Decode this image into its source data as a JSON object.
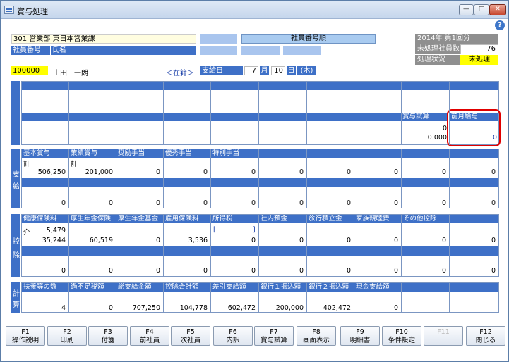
{
  "window": {
    "title": "賞与処理",
    "min": "—",
    "max": "□",
    "close": "✕"
  },
  "header": {
    "dept": "301 営業部 東日本営業課",
    "emp_no_label": "社員番号",
    "name_label": "氏名",
    "emp_no": "100000",
    "name": "山田　一朗",
    "status": "＜在籍＞",
    "btn_a": "",
    "btn_b": "",
    "btn_c": "",
    "btn_d": "",
    "btn_e": "",
    "order": "社員番号順",
    "pay_date_label": "支給日",
    "month": "7",
    "month_unit": "月",
    "day": "10",
    "day_unit": "日",
    "weekday": "(木)",
    "period": "2014年 第1回分",
    "unproc_label": "未処理社員数",
    "unproc_count": "76",
    "proc_label": "処理状況",
    "proc_value": "未処理"
  },
  "top": {
    "h_shoyo": "賞与試算",
    "h_zengetsu": "前月給与",
    "v1": "0",
    "v2": "0.000",
    "v3": "0"
  },
  "pay": {
    "side": [
      "支",
      "給"
    ],
    "headers": [
      "基本賞与",
      "業績賞与",
      "奨励手当",
      "優秀手当",
      "特別手当",
      "",
      "",
      "",
      "",
      ""
    ],
    "sub": [
      "計",
      "計",
      "",
      "",
      "",
      "",
      "",
      "",
      "",
      ""
    ],
    "row1": [
      "506,250",
      "201,000",
      "0",
      "0",
      "0",
      "0",
      "0",
      "0",
      "0",
      "0"
    ],
    "row2": [
      "0",
      "0",
      "0",
      "0",
      "0",
      "0",
      "0",
      "0",
      "0",
      "0"
    ]
  },
  "ded": {
    "side": [
      "控",
      "除"
    ],
    "headers": [
      "健康保険料",
      "厚生年金保険",
      "厚生年金基金",
      "雇用保険料",
      "所得税",
      "社内預金",
      "旅行積立金",
      "家族親睦費",
      "その他控除",
      ""
    ],
    "kaigo": "介",
    "kaigo_val": "5,479",
    "br_open": "[",
    "br_close": "]",
    "row1": [
      "35,244",
      "60,519",
      "0",
      "3,536",
      "0",
      "0",
      "0",
      "0",
      "0",
      "0"
    ],
    "row2": [
      "0",
      "0",
      "0",
      "0",
      "0",
      "0",
      "0",
      "0",
      "0",
      "0"
    ]
  },
  "calc": {
    "side": [
      "計",
      "算"
    ],
    "headers": [
      "扶養等の数",
      "過不足税額",
      "総支給金額",
      "控除合計額",
      "差引支給額",
      "銀行１振込額",
      "銀行２振込額",
      "現金支給額",
      "",
      ""
    ],
    "row": [
      "4",
      "0",
      "707,250",
      "104,778",
      "602,472",
      "200,000",
      "402,472",
      "0",
      "",
      ""
    ]
  },
  "fkeys": [
    {
      "k": "F1",
      "l": "操作説明"
    },
    {
      "k": "F2",
      "l": "印刷"
    },
    {
      "k": "F3",
      "l": "付箋"
    },
    {
      "k": "F4",
      "l": "前社員"
    },
    {
      "k": "F5",
      "l": "次社員"
    },
    {
      "k": "F6",
      "l": "内訳"
    },
    {
      "k": "F7",
      "l": "賞与試算"
    },
    {
      "k": "F8",
      "l": "画面表示"
    },
    {
      "k": "F9",
      "l": "明細書"
    },
    {
      "k": "F10",
      "l": "条件設定"
    },
    {
      "k": "F11",
      "l": ""
    },
    {
      "k": "F12",
      "l": "閉じる"
    }
  ],
  "colors": {
    "accent": "#3e70c7",
    "highlight": "#e00000",
    "status_bg": "#ffff00"
  }
}
